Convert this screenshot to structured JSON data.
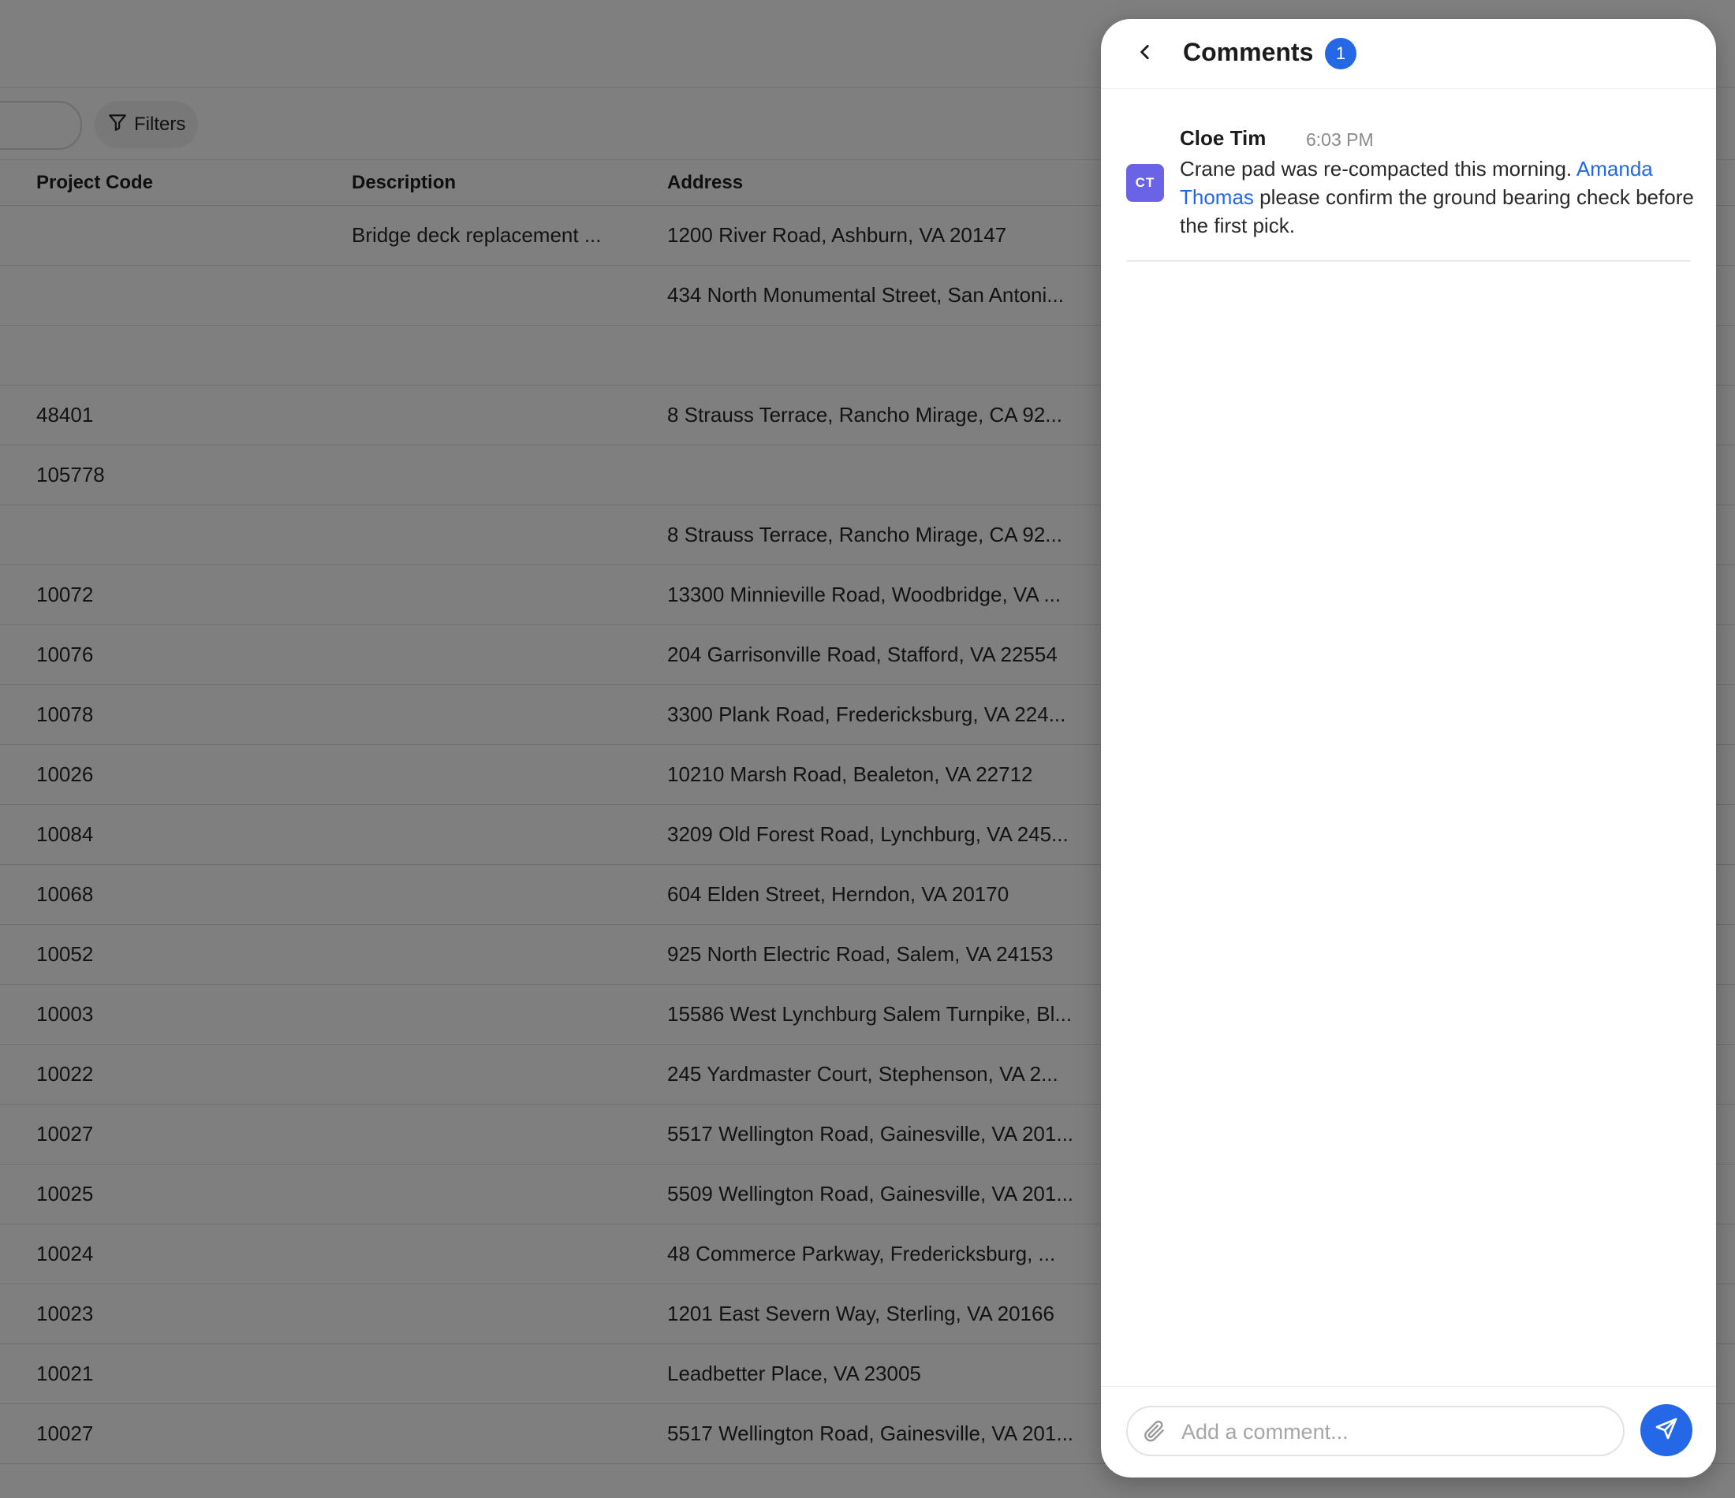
{
  "toolbar": {
    "filters_label": "Filters",
    "filter_icon": "funnel-icon"
  },
  "table": {
    "columns": [
      "Project Code",
      "Description",
      "Address"
    ],
    "rows": [
      {
        "code": "",
        "description": "Bridge deck replacement ...",
        "address": "1200 River Road, Ashburn, VA 20147"
      },
      {
        "code": "",
        "description": "",
        "address": "434 North Monumental Street, San Antoni..."
      },
      {
        "code": "",
        "description": "",
        "address": ""
      },
      {
        "code": "48401",
        "description": "",
        "address": "8 Strauss Terrace, Rancho Mirage, CA 92..."
      },
      {
        "code": "105778",
        "description": "",
        "address": ""
      },
      {
        "code": "",
        "description": "",
        "address": "8 Strauss Terrace, Rancho Mirage, CA 92..."
      },
      {
        "code": "10072",
        "description": "",
        "address": "13300 Minnieville Road, Woodbridge, VA ..."
      },
      {
        "code": "10076",
        "description": "",
        "address": "204 Garrisonville Road, Stafford, VA 22554"
      },
      {
        "code": "10078",
        "description": "",
        "address": "3300 Plank Road, Fredericksburg, VA 224..."
      },
      {
        "code": "10026",
        "description": "",
        "address": "10210 Marsh Road, Bealeton, VA 22712"
      },
      {
        "code": "10084",
        "description": "",
        "address": "3209 Old Forest Road, Lynchburg, VA 245..."
      },
      {
        "code": "10068",
        "description": "",
        "address": "604 Elden Street, Herndon, VA 20170"
      },
      {
        "code": "10052",
        "description": "",
        "address": "925 North Electric Road, Salem, VA 24153"
      },
      {
        "code": "10003",
        "description": "",
        "address": "15586 West Lynchburg Salem Turnpike, Bl..."
      },
      {
        "code": "10022",
        "description": "",
        "address": "245 Yardmaster Court, Stephenson, VA 2..."
      },
      {
        "code": "10027",
        "description": "",
        "address": "5517 Wellington Road, Gainesville, VA 201..."
      },
      {
        "code": "10025",
        "description": "",
        "address": "5509 Wellington Road, Gainesville, VA 201..."
      },
      {
        "code": "10024",
        "description": "",
        "address": "48 Commerce Parkway, Fredericksburg, ..."
      },
      {
        "code": "10023",
        "description": "",
        "address": "1201 East Severn Way, Sterling, VA 20166"
      },
      {
        "code": "10021",
        "description": "",
        "address": "Leadbetter Place, VA 23005"
      },
      {
        "code": "10027",
        "description": "",
        "address": "5517 Wellington Road, Gainesville, VA 201..."
      }
    ]
  },
  "comments_panel": {
    "title": "Comments",
    "count": "1",
    "back_icon": "chevron-left-icon",
    "comments": [
      {
        "avatar_initials": "CT",
        "avatar_color": "#6b63e6",
        "author": "Cloe Tim",
        "time": "6:03 PM",
        "body_before": "Crane pad was re-compacted this morning. ",
        "mention": "Amanda Thomas",
        "body_after": " please confirm the ground bearing check before the first pick."
      }
    ],
    "composer": {
      "placeholder": "Add a comment...",
      "value": "",
      "attach_icon": "paperclip-icon",
      "send_icon": "send-icon"
    }
  },
  "colors": {
    "accent": "#2468e8",
    "overlay": "rgba(0,0,0,0.5)",
    "mention": "#2468e8"
  }
}
